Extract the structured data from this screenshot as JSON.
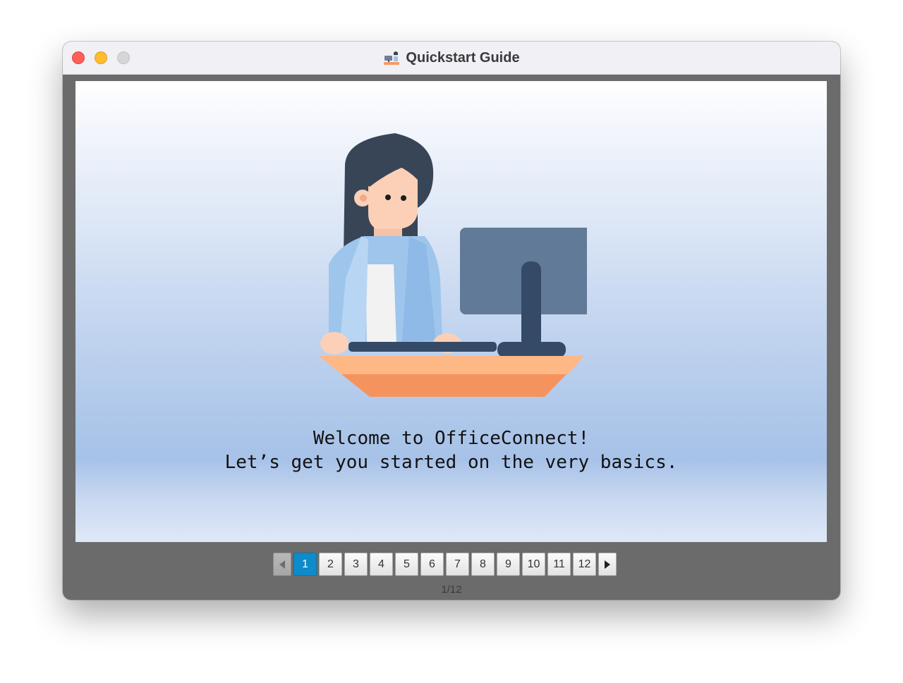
{
  "window": {
    "title": "Quickstart Guide",
    "title_icon": "office-desk-icon",
    "controls": [
      "close",
      "minimize",
      "maximize"
    ]
  },
  "slide": {
    "illustration": "woman-at-computer-desk",
    "line1": "Welcome to OfficeConnect!",
    "line2": "Let’s get you started on the very basics."
  },
  "pagination": {
    "prev_icon": "triangle-left-icon",
    "next_icon": "triangle-right-icon",
    "pages": [
      "1",
      "2",
      "3",
      "4",
      "5",
      "6",
      "7",
      "8",
      "9",
      "10",
      "11",
      "12"
    ],
    "current": 1,
    "counter": "1/12"
  },
  "colors": {
    "active_page": "#0e8bcb",
    "window_frame": "#6b6b6b",
    "titlebar": "#f1f0f5"
  }
}
